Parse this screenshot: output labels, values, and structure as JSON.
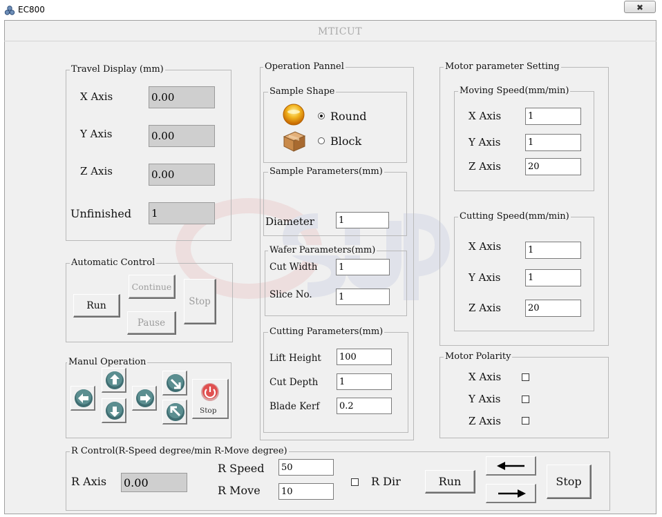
{
  "window": {
    "title": "EC800",
    "close_glyph": "✖"
  },
  "app": {
    "title": "MTICUT"
  },
  "travel_display": {
    "group_label": "Travel Display (mm)",
    "x_label": "X Axis",
    "x_value": "0.00",
    "y_label": "Y Axis",
    "y_value": "0.00",
    "z_label": "Z Axis",
    "z_value": "0.00",
    "unfinished_label": "Unfinished",
    "unfinished_value": "1"
  },
  "automatic_control": {
    "group_label": "Automatic Control",
    "run": "Run",
    "continue": "Continue",
    "pause": "Pause",
    "stop": "Stop"
  },
  "manual_operation": {
    "group_label": "Manul Operation",
    "stop": "Stop",
    "icons": [
      "arrow-left-icon",
      "arrow-up-icon",
      "arrow-down-icon",
      "arrow-right-icon",
      "arrow-down-right-icon",
      "arrow-up-left-icon",
      "power-icon"
    ]
  },
  "operation_panel": {
    "group_label": "Operation Pannel",
    "sample_shape": {
      "label": "Sample Shape",
      "round": "Round",
      "block": "Block",
      "selected": "Round"
    },
    "sample_parameters": {
      "label": "Sample Parameters(mm)",
      "diameter_label": "Diameter",
      "diameter": "1"
    },
    "wafer_parameters": {
      "label": "Wafer Parameters(mm)",
      "cut_width_label": "Cut Width",
      "cut_width": "1",
      "slice_no_label": "Slice No.",
      "slice_no": "1"
    },
    "cutting_parameters": {
      "label": "Cutting Parameters(mm)",
      "lift_height_label": "Lift Height",
      "lift_height": "100",
      "cut_depth_label": "Cut Depth",
      "cut_depth": "1",
      "blade_kerf_label": "Blade Kerf",
      "blade_kerf": "0.2"
    }
  },
  "motor_parameter": {
    "group_label": "Motor parameter Setting",
    "moving_speed": {
      "label": "Moving Speed(mm/min)",
      "x_label": "X Axis",
      "x": "1",
      "y_label": "Y Axis",
      "y": "1",
      "z_label": "Z Axis",
      "z": "20"
    },
    "cutting_speed": {
      "label": "Cutting Speed(mm/min)",
      "x_label": "X Axis",
      "x": "1",
      "y_label": "Y Axis",
      "y": "1",
      "z_label": "Z Axis",
      "z": "20"
    }
  },
  "motor_polarity": {
    "group_label": "Motor Polarity",
    "x_label": "X Axis",
    "y_label": "Y Axis",
    "z_label": "Z Axis",
    "x_checked": false,
    "y_checked": false,
    "z_checked": false
  },
  "r_control": {
    "group_label": "R Control(R-Speed degree/min  R-Move degree)",
    "r_axis_label": "R Axis",
    "r_axis_value": "0.00",
    "r_speed_label": "R Speed",
    "r_speed": "50",
    "r_move_label": "R Move",
    "r_move": "10",
    "r_dir_label": "R Dir",
    "r_dir_checked": false,
    "run": "Run",
    "stop": "Stop"
  },
  "colors": {
    "client_bg": "#f0f0f0",
    "readonly_bg": "#cfcfcf",
    "watermark": "#d63030"
  }
}
